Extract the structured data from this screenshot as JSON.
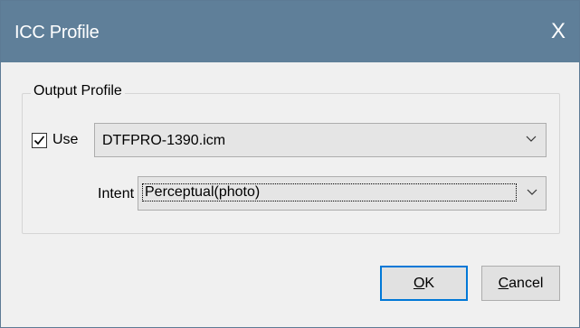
{
  "window": {
    "title": "ICC Profile",
    "close_glyph": "X"
  },
  "group": {
    "legend": "Output Profile"
  },
  "use_checkbox": {
    "checked": true,
    "label": "Use"
  },
  "profile_select": {
    "value": "DTFPRO-1390.icm"
  },
  "intent": {
    "label": "Intent",
    "value": "Perceptual(photo)"
  },
  "buttons": {
    "ok": {
      "mnemonic": "O",
      "rest": "K"
    },
    "cancel": {
      "mnemonic": "C",
      "rest": "ancel"
    }
  },
  "colors": {
    "titlebar": "#5f7f99",
    "focus": "#0078d7",
    "background": "#f0f0f0"
  }
}
